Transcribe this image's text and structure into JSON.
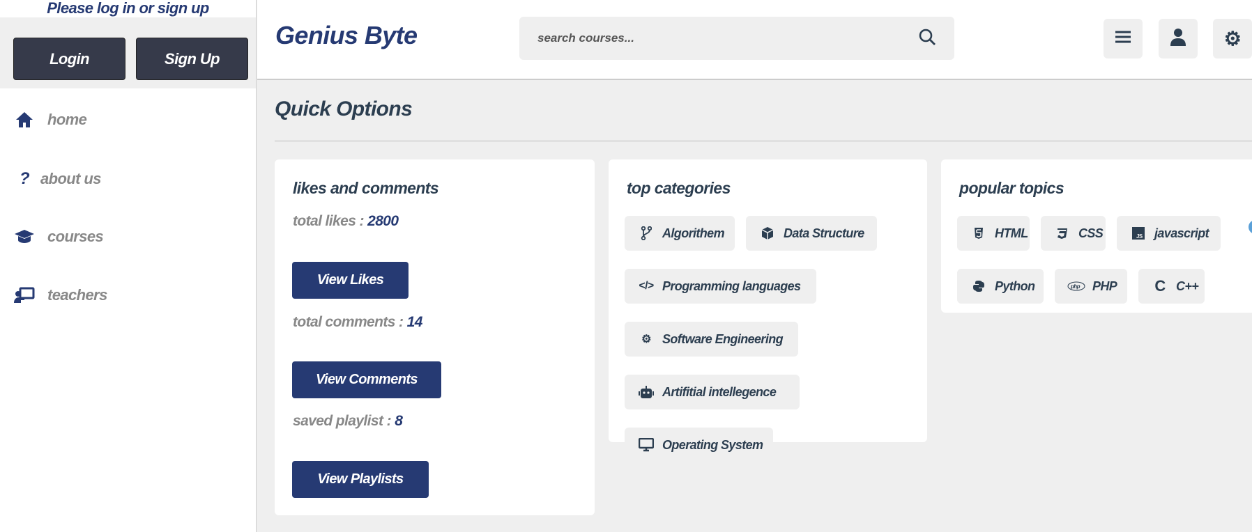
{
  "sidebar": {
    "login_message": "Please log in or sign up",
    "login_label": "Login",
    "signup_label": "Sign Up",
    "nav": [
      {
        "label": "home",
        "icon": "home-icon"
      },
      {
        "label": "about us",
        "icon": "question-icon"
      },
      {
        "label": "courses",
        "icon": "graduation-cap-icon"
      },
      {
        "label": "teachers",
        "icon": "chalkboard-teacher-icon"
      }
    ]
  },
  "header": {
    "logo": "Genius Byte",
    "search_placeholder": "search courses..."
  },
  "main": {
    "title": "Quick Options",
    "likes_card": {
      "title": "likes and comments",
      "total_likes_label": "total likes : ",
      "total_likes": "2800",
      "view_likes": "View Likes",
      "total_comments_label": "total comments : ",
      "total_comments": "14",
      "view_comments": "View Comments",
      "saved_playlist_label": "saved playlist : ",
      "saved_playlist": "8",
      "view_playlists": "View Playlists"
    },
    "categories_card": {
      "title": "top categories",
      "items": [
        "Algorithem",
        "Data Structure",
        "Programming languages",
        "Software Engineering",
        "Artifitial intellegence",
        "Operating System"
      ]
    },
    "topics_card": {
      "title": "popular topics",
      "items": [
        "HTML",
        "CSS",
        "javascript",
        "Python",
        "PHP",
        "C++"
      ]
    }
  },
  "colors": {
    "brand": "#263a73",
    "dark_button": "#363a4a",
    "text": "#2c3e50",
    "muted": "#888888",
    "background": "#efefef"
  }
}
